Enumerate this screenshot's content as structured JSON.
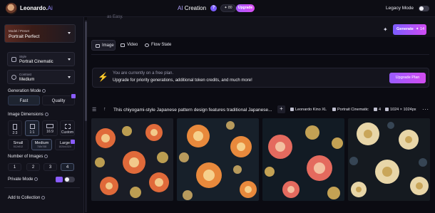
{
  "brand": {
    "name_main": "Leonardo.",
    "name_ai": "Ai"
  },
  "header": {
    "title_prefix": "AI",
    "title_main": " Creation",
    "help_symbol": "?",
    "credits": "80",
    "upgrade_label": "Upgrade",
    "legacy_mode_label": "Legacy Mode"
  },
  "sidebar": {
    "preset": {
      "small_label": "Model / Preset",
      "value": "Portrait Perfect"
    },
    "style": {
      "small_label": "Style",
      "value": "Portrait Cinematic"
    },
    "contrast": {
      "small_label": "Contrast",
      "value": "Medium"
    },
    "generation_mode": {
      "label": "Generation Mode",
      "options": [
        "Fast",
        "Quality"
      ],
      "selected": "Fast"
    },
    "image_dimensions": {
      "label": "Image Dimensions",
      "ratios": [
        "2:3",
        "1:1",
        "16:9",
        "Custom"
      ],
      "selected_ratio": "1:1",
      "sizes": [
        {
          "label": "Small",
          "sub": "512x512"
        },
        {
          "label": "Medium",
          "sub": "768x768"
        },
        {
          "label": "Large",
          "sub": "1024x1024"
        }
      ],
      "selected_size": "Medium"
    },
    "number_of_images": {
      "label": "Number of Images",
      "options": [
        "1",
        "2",
        "3",
        "4"
      ],
      "selected": "4"
    },
    "private_mode": {
      "label": "Private Mode"
    },
    "add_to_collection": {
      "label": "Add to Collection"
    }
  },
  "main": {
    "prompt_hint": "as Easy.",
    "generate": {
      "label": "Generate",
      "cost": "14"
    },
    "tabs": [
      {
        "label": "Image",
        "active": true
      },
      {
        "label": "Video",
        "active": false
      },
      {
        "label": "Flow State",
        "active": false
      }
    ],
    "banner": {
      "line1": "You are currently on a free plan.",
      "line2": "Upgrade for priority generations, additional token credits, and much more!",
      "button": "Upgrade Plan"
    },
    "result": {
      "prompt": "This chiyogami-style Japanese pattern design features traditional Japanese...",
      "plus_symbol": "+",
      "model": "Leonardo Kino XL",
      "style": "Portrait Cinematic",
      "count": "4",
      "dimensions": "1024 × 1024px",
      "more_symbol": "···"
    }
  },
  "colors": {
    "background": "#0b0b12",
    "accent_purple": "#7b5cff",
    "accent_pink": "#d14cf2",
    "bolt_orange": "#ffb02e"
  }
}
